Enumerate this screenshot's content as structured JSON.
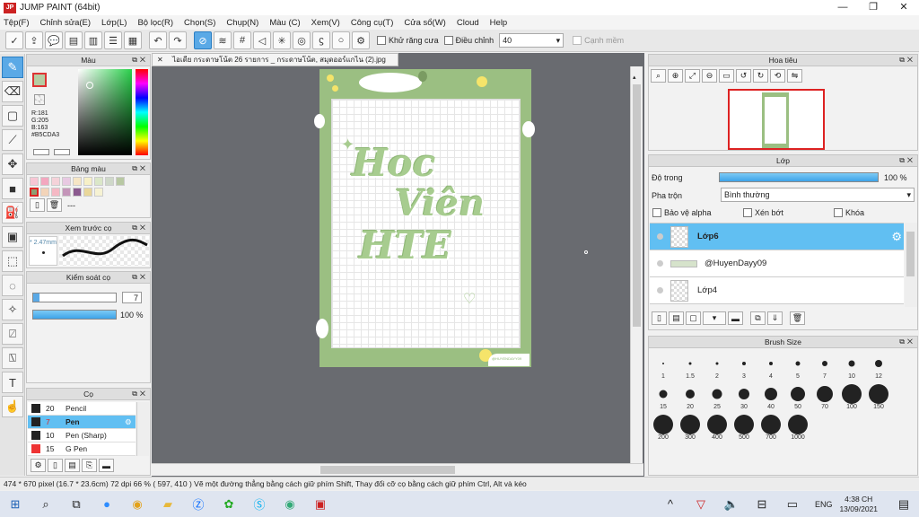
{
  "app": {
    "title": "JUMP PAINT (64bit)",
    "logo": "JP"
  },
  "menu": [
    "Tệp(F)",
    "Chỉnh sửa(E)",
    "Lớp(L)",
    "Bộ lọc(R)",
    "Chọn(S)",
    "Chụp(N)",
    "Màu (C)",
    "Xem(V)",
    "Công cụ(T)",
    "Cửa sổ(W)",
    "Cloud",
    "Help"
  ],
  "toolbar": {
    "antialias": "Khử răng cưa",
    "adjust": "Điều chỉnh",
    "adjust_value": "40",
    "edge": "Cạnh mềm"
  },
  "color_panel": {
    "title": "Màu",
    "r": "R:181",
    "g": "G:205",
    "b": "B:163",
    "hex": "#B5CDA3",
    "accent": "#B5CDA3"
  },
  "palette_panel": {
    "title": "Bảng màu",
    "swatches": [
      "#f7c6d4",
      "#f3a7bf",
      "#f5d2d9",
      "#e8c9e2",
      "#f6e6c5",
      "#f7f0c7",
      "#dbe7c8",
      "#cfd8c9",
      "#b8c8a3",
      "#8e9e73",
      "#f3d4b9",
      "#f5b8c4",
      "#c495b9",
      "#8b5a8f",
      "#e9d79a",
      "#f6f2d3"
    ],
    "more": "---"
  },
  "brush_preview": {
    "title": "Xem trước cọ",
    "size": "* 2.47mm"
  },
  "brush_control": {
    "title": "Kiểm soát cọ",
    "size_value": "7",
    "opacity": "100 %"
  },
  "brush_list": {
    "title": "Cọ",
    "items": [
      {
        "num": "20",
        "name": "Pencil",
        "color": "#222222"
      },
      {
        "num": "7",
        "name": "Pen",
        "color": "#222222"
      },
      {
        "num": "10",
        "name": "Pen (Sharp)",
        "color": "#222222"
      },
      {
        "num": "15",
        "name": "G Pen",
        "color": "#e33333"
      }
    ]
  },
  "document": {
    "tab": "ไอเดีย กระดาษโน้ต 26 รายการ _ กระดาษโน้ต, สมุดออร์แกไน (2).jpg"
  },
  "artwork": {
    "line1": "Hoc",
    "line2": "Viên",
    "line3": "HTE",
    "credit": "@HUYENDAYY09"
  },
  "navigator": {
    "title": "Hoa tiêu"
  },
  "layers": {
    "title": "Lớp",
    "opacity_label": "Độ trong",
    "opacity_value": "100 %",
    "blend_label": "Pha trộn",
    "blend_value": "Bình thường",
    "protect_alpha": "Bảo vệ alpha",
    "clip": "Xén bớt",
    "lock": "Khóa",
    "items": [
      {
        "name": "Lớp6"
      },
      {
        "name": "@HuyenDayy09"
      },
      {
        "name": "Lớp4"
      }
    ]
  },
  "brush_size": {
    "title": "Brush Size",
    "sizes": [
      "1",
      "1.5",
      "2",
      "3",
      "4",
      "5",
      "7",
      "10",
      "12",
      "15",
      "20",
      "25",
      "30",
      "40",
      "50",
      "70",
      "100",
      "150",
      "200",
      "300",
      "400",
      "500",
      "700",
      "1000"
    ]
  },
  "status": {
    "text": "474 * 670 pixel   (16.7 * 23.6cm)    72 dpi    66 %    ( 597, 410 )    Vẽ một đường thẳng bằng cách giữ phím Shift, Thay đổi cỡ cọ bằng cách giữ phím Ctrl, Alt và kéo"
  },
  "taskbar": {
    "lang": "ENG",
    "time": "4:38 CH",
    "date": "13/09/2021"
  }
}
